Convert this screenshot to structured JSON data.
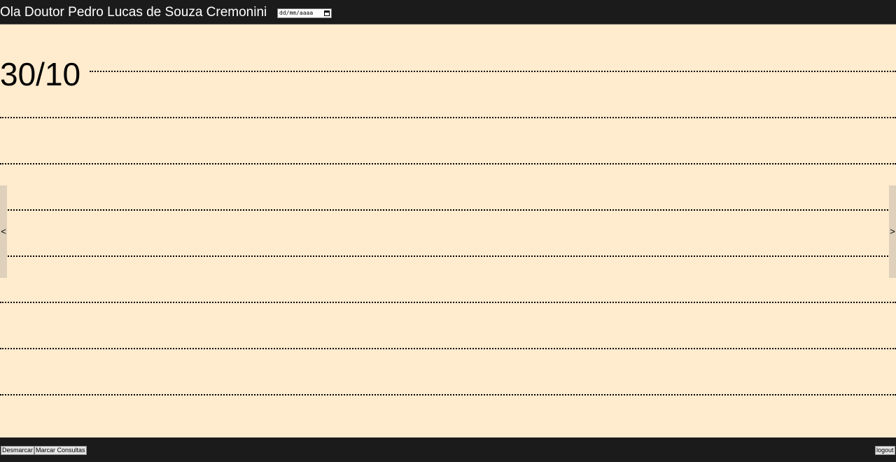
{
  "header": {
    "greeting": "Ola Doutor Pedro Lucas de Souza Cremonini",
    "date_placeholder": "dd/mm/aaaa"
  },
  "schedule": {
    "day_label": "30/10",
    "slot_count": 8
  },
  "navigation": {
    "prev_label": "<",
    "next_label": ">"
  },
  "footer": {
    "desmarcar_label": "Desmarcar",
    "marcar_label": "Marcar Consultas",
    "logout_label": "logout"
  },
  "colors": {
    "bar_background": "#1b1b1b",
    "page_background": "#ffebcd",
    "nav_button": "#ded0bb"
  }
}
